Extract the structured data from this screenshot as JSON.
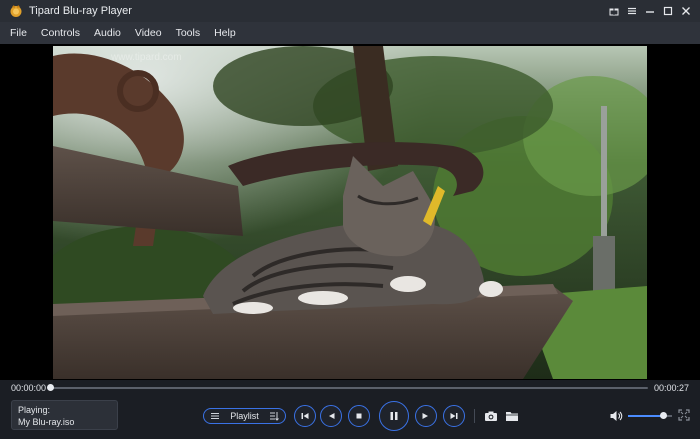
{
  "window": {
    "title": "Tipard Blu-ray Player"
  },
  "menu": {
    "items": [
      "File",
      "Controls",
      "Audio",
      "Video",
      "Tools",
      "Help"
    ]
  },
  "video": {
    "watermark": "www.tipard.com"
  },
  "playback": {
    "current_time": "00:00:00",
    "total_time": "00:00:27",
    "progress": 0.0,
    "volume": 0.8
  },
  "now_playing": {
    "label": "Playing:",
    "file": "My Blu-ray.iso"
  },
  "controls": {
    "playlist_label": "Playlist"
  },
  "colors": {
    "accent": "#3a72e6",
    "background": "#1b1e24",
    "menubar": "#2f333b",
    "titlebar": "#2a2e35"
  }
}
